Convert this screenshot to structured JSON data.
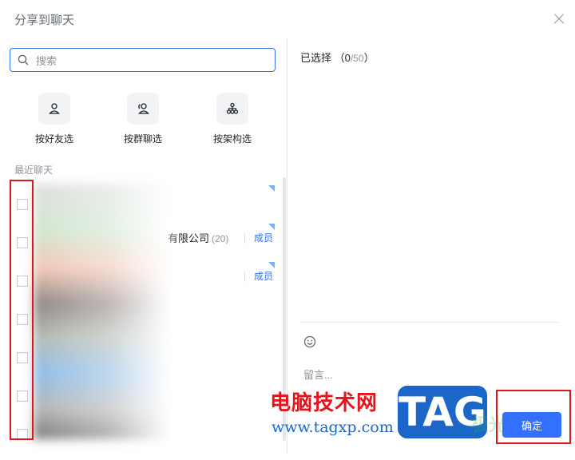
{
  "dialog": {
    "title": "分享到聊天",
    "close_icon": "close-icon"
  },
  "search": {
    "placeholder": "搜索",
    "value": ""
  },
  "filters": [
    {
      "label": "按好友选",
      "icon": "person-icon"
    },
    {
      "label": "按群聊选",
      "icon": "group-icon"
    },
    {
      "label": "按架构选",
      "icon": "org-chart-icon"
    }
  ],
  "recent": {
    "label": "最近聊天",
    "items": [
      {
        "name": "",
        "count": "",
        "member": ""
      },
      {
        "name": "有限公司",
        "count": "(20)",
        "member": "成员"
      },
      {
        "name": "",
        "count": "",
        "member": "成员"
      },
      {
        "name": "",
        "count": "",
        "member": ""
      },
      {
        "name": "",
        "count": "",
        "member": ""
      },
      {
        "name": "",
        "count": "",
        "member": ""
      },
      {
        "name": "",
        "count": "",
        "member": ""
      }
    ]
  },
  "selected": {
    "label": "已选择",
    "open_paren": "（",
    "count": "0",
    "max": "/50",
    "close_paren": "）"
  },
  "message": {
    "placeholder": "留言..."
  },
  "actions": {
    "confirm_label": "确定"
  },
  "watermark": {
    "site_name": "电脑技术网",
    "url": "www.tagxp.com",
    "badge": "TAG",
    "faint": "极光下载站"
  },
  "colors": {
    "accent": "#3370ff",
    "highlight_box": "#e0161d"
  }
}
